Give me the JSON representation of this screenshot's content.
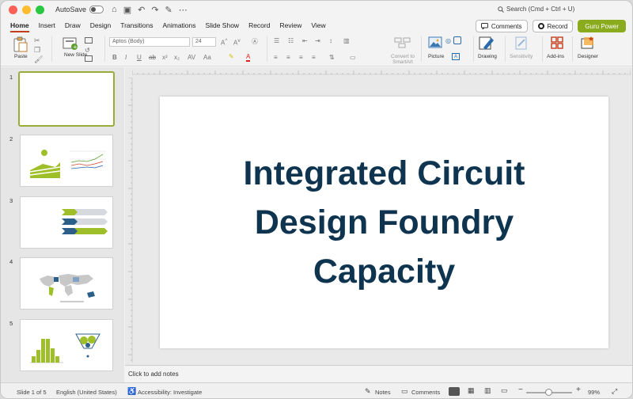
{
  "titlebar": {
    "autosave_label": "AutoSave",
    "search_placeholder": "Search (Cmd + Ctrl + U)"
  },
  "menu": {
    "tabs": [
      "Home",
      "Insert",
      "Draw",
      "Design",
      "Transitions",
      "Animations",
      "Slide Show",
      "Record",
      "Review",
      "View"
    ],
    "active": "Home",
    "comments_label": "Comments",
    "record_label": "Record",
    "guru_label": "Guru Power"
  },
  "ribbon": {
    "paste_label": "Paste",
    "new_slide_label": "New Slide",
    "font_name": "Aptos (Body)",
    "font_size": "24",
    "convert_smartart_label": "Convert to SmartArt",
    "picture_label": "Picture",
    "drawing_label": "Drawing",
    "sensitivity_label": "Sensitivity",
    "addins_label": "Add-ins",
    "designer_label": "Designer"
  },
  "thumbnails": {
    "numbers": [
      "1",
      "2",
      "3",
      "4",
      "5"
    ]
  },
  "slide": {
    "title": "Integrated Circuit Design Foundry Capacity"
  },
  "notes": {
    "placeholder": "Click to add notes"
  },
  "status": {
    "slide_counter": "Slide 1 of 5",
    "language": "English (United States)",
    "accessibility": "Accessibility: Investigate",
    "notes_label": "Notes",
    "comments_label": "Comments",
    "zoom": "99%"
  },
  "colors": {
    "title_color": "#0e3450",
    "accent_green": "#8aab1e",
    "tab_underline": "#c43e1c"
  }
}
